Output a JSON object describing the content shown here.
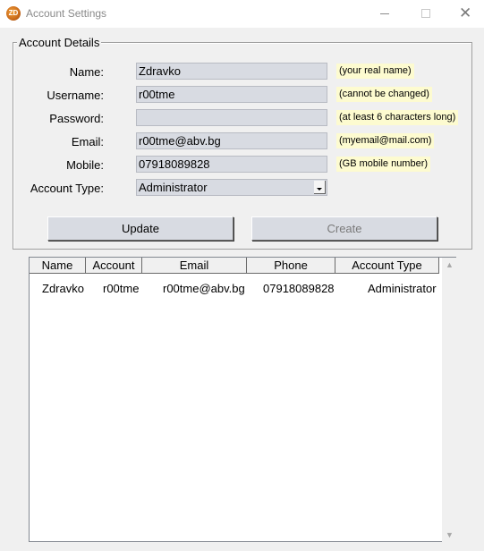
{
  "window": {
    "title": "Account Settings",
    "app_icon": "app-logo-icon",
    "minimize_icon": "minimize-icon",
    "maximize_icon": "maximize-icon",
    "close_icon": "close-icon"
  },
  "account_details": {
    "legend": "Account Details",
    "fields": {
      "name": {
        "label": "Name:",
        "value": "Zdravko",
        "hint": "(your real name)"
      },
      "username": {
        "label": "Username:",
        "value": "r00tme",
        "hint": "(cannot be changed)"
      },
      "password": {
        "label": "Password:",
        "value": "",
        "hint": "(at least 6 characters long)"
      },
      "email": {
        "label": "Email:",
        "value": "r00tme@abv.bg",
        "hint": "(myemail@mail.com)"
      },
      "mobile": {
        "label": "Mobile:",
        "value": "07918089828",
        "hint": "(GB mobile number)"
      },
      "account_type": {
        "label": "Account Type:",
        "value": "Administrator"
      }
    },
    "buttons": {
      "update": "Update",
      "create": "Create"
    }
  },
  "accounts_table": {
    "columns": [
      "Name",
      "Account",
      "Email",
      "Phone",
      "Account Type"
    ],
    "rows": [
      [
        "Zdravko",
        "r00tme",
        "r00tme@abv.bg",
        "07918089828",
        "Administrator"
      ]
    ]
  },
  "colors": {
    "field_bg": "#d8dbe2",
    "hint_bg": "#fdfbd0",
    "window_bg": "#f0f0f0"
  }
}
